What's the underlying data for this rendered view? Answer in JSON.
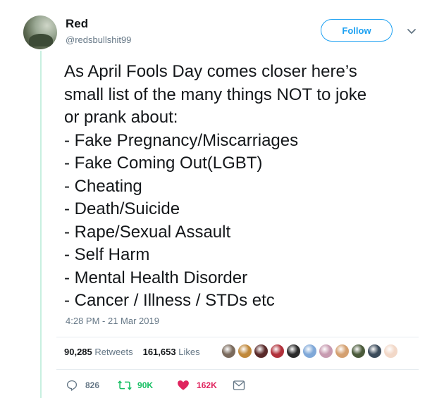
{
  "user": {
    "name": "Red",
    "handle": "@redsbullshit99"
  },
  "follow_label": "Follow",
  "tweet_lines": [
    "As April Fools Day comes closer here’s",
    "small list of the many things NOT to joke",
    "or prank about:",
    "- Fake Pregnancy/Miscarriages",
    "- Fake Coming Out(LGBT)",
    "- Cheating",
    "- Death/Suicide",
    "- Rape/Sexual Assault",
    "- Self Harm",
    "- Mental Health Disorder",
    "- Cancer / Illness / STDs etc"
  ],
  "timestamp": "4:28 PM - 21 Mar 2019",
  "stats": {
    "retweets_count": "90,285",
    "retweets_label": "Retweets",
    "likes_count": "161,653",
    "likes_label": "Likes"
  },
  "likers": [
    {
      "color": "#7a6a5c"
    },
    {
      "color": "#c0883a"
    },
    {
      "color": "#5a2a2a"
    },
    {
      "color": "#b0303a"
    },
    {
      "color": "#2a2a2a"
    },
    {
      "color": "#7fa8d8"
    },
    {
      "color": "#c79ab0"
    },
    {
      "color": "#d4a070"
    },
    {
      "color": "#4a5a3a"
    },
    {
      "color": "#3a4a5a"
    },
    {
      "color": "#f2d8c8"
    }
  ],
  "actions": {
    "reply_count": "826",
    "retweet_count": "90K",
    "like_count": "162K"
  },
  "colors": {
    "accent": "#1da1f2",
    "retweet": "#17bf63",
    "like": "#e0245e",
    "secondary_text": "#657786"
  }
}
